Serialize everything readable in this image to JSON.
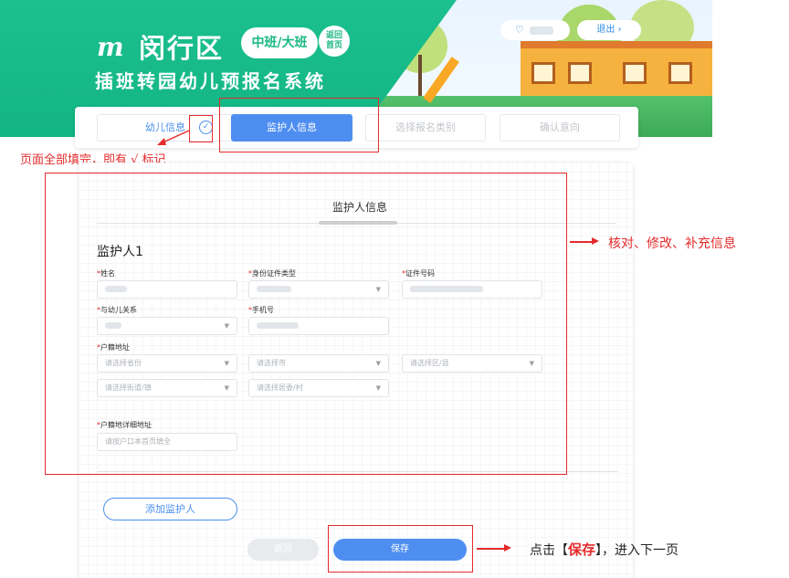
{
  "header": {
    "logo_mark": "m",
    "district": "闵行区",
    "grade_badge": "中班/大班",
    "home_link": [
      "返回",
      "首页"
    ],
    "system_title": "插班转园幼儿预报名系统",
    "user_icon": "user-icon",
    "logout_label": "退出",
    "logout_icon": "chevron-right-icon"
  },
  "steps": [
    {
      "label": "幼儿信息",
      "state": "done"
    },
    {
      "label": "监护人信息",
      "state": "active"
    },
    {
      "label": "选择报名类别",
      "state": "pending"
    },
    {
      "label": "确认意向",
      "state": "pending"
    }
  ],
  "step_done_icon": "check-circle-icon",
  "form": {
    "section_title": "监护人信息",
    "guardian_title": "监护人1",
    "required_mark": "*",
    "fields": {
      "name": {
        "label": "姓名"
      },
      "id_type": {
        "label": "身份证件类型"
      },
      "id_number": {
        "label": "证件号码"
      },
      "relation": {
        "label": "与幼儿关系"
      },
      "phone": {
        "label": "手机号"
      },
      "hukou": {
        "label": "户籍地址"
      },
      "province": {
        "placeholder": "请选择省份"
      },
      "city": {
        "placeholder": "请选择市"
      },
      "district": {
        "placeholder": "请选择区/县"
      },
      "street": {
        "placeholder": "请选择街道/镇"
      },
      "committee": {
        "placeholder": "请选择居委/村"
      },
      "hukou_detail": {
        "label": "户籍地详细地址",
        "placeholder": "请按户口本首页填全"
      }
    },
    "add_guardian": "添加监护人",
    "back": "返回",
    "save": "保存"
  },
  "annotations": {
    "complete_note": "页面全部填完，即有 √ 标记",
    "check_note": "核对、修改、补充信息",
    "save_note_prefix": "点击【",
    "save_note_em": "保存",
    "save_note_suffix": "】，进入下一页"
  },
  "colors": {
    "banner_green": "#1cc08e",
    "accent_blue": "#4e8ef1",
    "annotation_red": "#e52b2b"
  }
}
